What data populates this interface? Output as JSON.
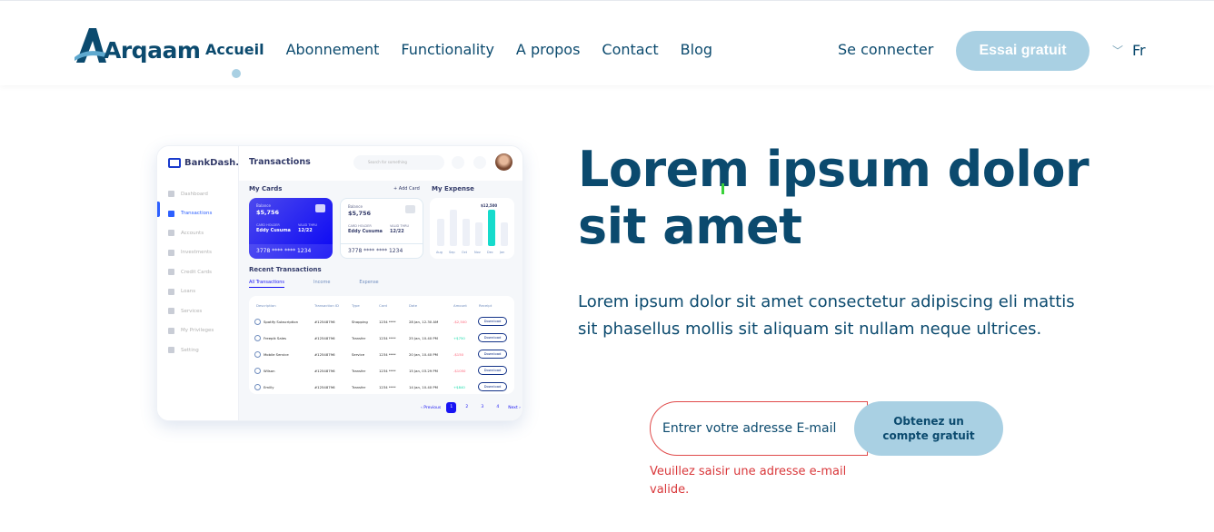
{
  "brand": {
    "name": "Arqaam"
  },
  "nav": {
    "items": [
      {
        "label": "Accueil",
        "active": true
      },
      {
        "label": "Abonnement"
      },
      {
        "label": "Functionality"
      },
      {
        "label": "A propos"
      },
      {
        "label": "Contact"
      },
      {
        "label": "Blog"
      }
    ],
    "login": "Se connecter",
    "trial": "Essai gratuit",
    "language": "Fr",
    "language_icon": "chevron-down-icon"
  },
  "dashboard": {
    "brand": "BankDash.",
    "title": "Transactions",
    "search_placeholder": "Search for something",
    "menu": [
      "Dashboard",
      "Transactions",
      "Accounts",
      "Investments",
      "Credit Cards",
      "Loans",
      "Services",
      "My Privileges",
      "Setting"
    ],
    "my_cards": "My Cards",
    "add_card": "+ Add Card",
    "my_expense": "My Expense",
    "cards": [
      {
        "balance_label": "Balance",
        "balance": "$5,756",
        "holder_label": "CARD HOLDER",
        "holder": "Eddy Cusuma",
        "thru_label": "VALID THRU",
        "thru": "12/22",
        "number": "3778 **** **** 1234"
      },
      {
        "balance_label": "Balance",
        "balance": "$5,756",
        "holder_label": "CARD HOLDER",
        "holder": "Eddy Cusuma",
        "thru_label": "VALID THRU",
        "thru": "12/22",
        "number": "3778 **** **** 1234"
      }
    ],
    "expense": {
      "value_label": "$12,500",
      "months": [
        "Aug",
        "Sep",
        "Oct",
        "Nov",
        "Dec",
        "Jan"
      ],
      "highlight": "Dec"
    },
    "recent": "Recent Transactions",
    "tabs": [
      "All Transactions",
      "Income",
      "Expense"
    ],
    "columns": [
      "Description",
      "Transaction ID",
      "Type",
      "Card",
      "Date",
      "Amount",
      "Receipt"
    ],
    "rows": [
      {
        "desc": "Spotify Subscription",
        "id": "#12548796",
        "type": "Shopping",
        "card": "1234 ****",
        "date": "28 Jan, 12.30 AM",
        "amount": "-$2,500",
        "sign": "neg",
        "receipt": "Download"
      },
      {
        "desc": "Freepik Sales",
        "id": "#12548796",
        "type": "Transfer",
        "card": "1234 ****",
        "date": "25 Jan, 10.40 PM",
        "amount": "+$750",
        "sign": "pos",
        "receipt": "Download"
      },
      {
        "desc": "Mobile Service",
        "id": "#12548796",
        "type": "Service",
        "card": "1234 ****",
        "date": "20 Jan, 10.40 PM",
        "amount": "-$150",
        "sign": "neg",
        "receipt": "Download"
      },
      {
        "desc": "Wilson",
        "id": "#12548796",
        "type": "Transfer",
        "card": "1234 ****",
        "date": "15 Jan, 03.29 PM",
        "amount": "-$1050",
        "sign": "neg",
        "receipt": "Download"
      },
      {
        "desc": "Emilly",
        "id": "#12548796",
        "type": "Transfer",
        "card": "1234 ****",
        "date": "14 Jan, 10.40 PM",
        "amount": "+$840",
        "sign": "pos",
        "receipt": "Download"
      }
    ],
    "pager": {
      "previous": "‹ Previous",
      "pages": [
        "1",
        "2",
        "3",
        "4"
      ],
      "next": "Next ›"
    }
  },
  "hero": {
    "title": "Lorem ipsum dolor sit amet",
    "subtitle": "Lorem ipsum dolor sit amet consectetur adipiscing eli mattis sit phasellus mollis sit aliquam sit nullam neque ultrices."
  },
  "signup": {
    "placeholder": "Entrer votre adresse E-mail",
    "value": "",
    "button": "Obtenez un compte gratuit",
    "error": "Veuillez saisir une adresse e-mail valide."
  },
  "colors": {
    "primary": "#0b4a6e",
    "accent": "#a9d0e3",
    "error": "#d9383b"
  }
}
